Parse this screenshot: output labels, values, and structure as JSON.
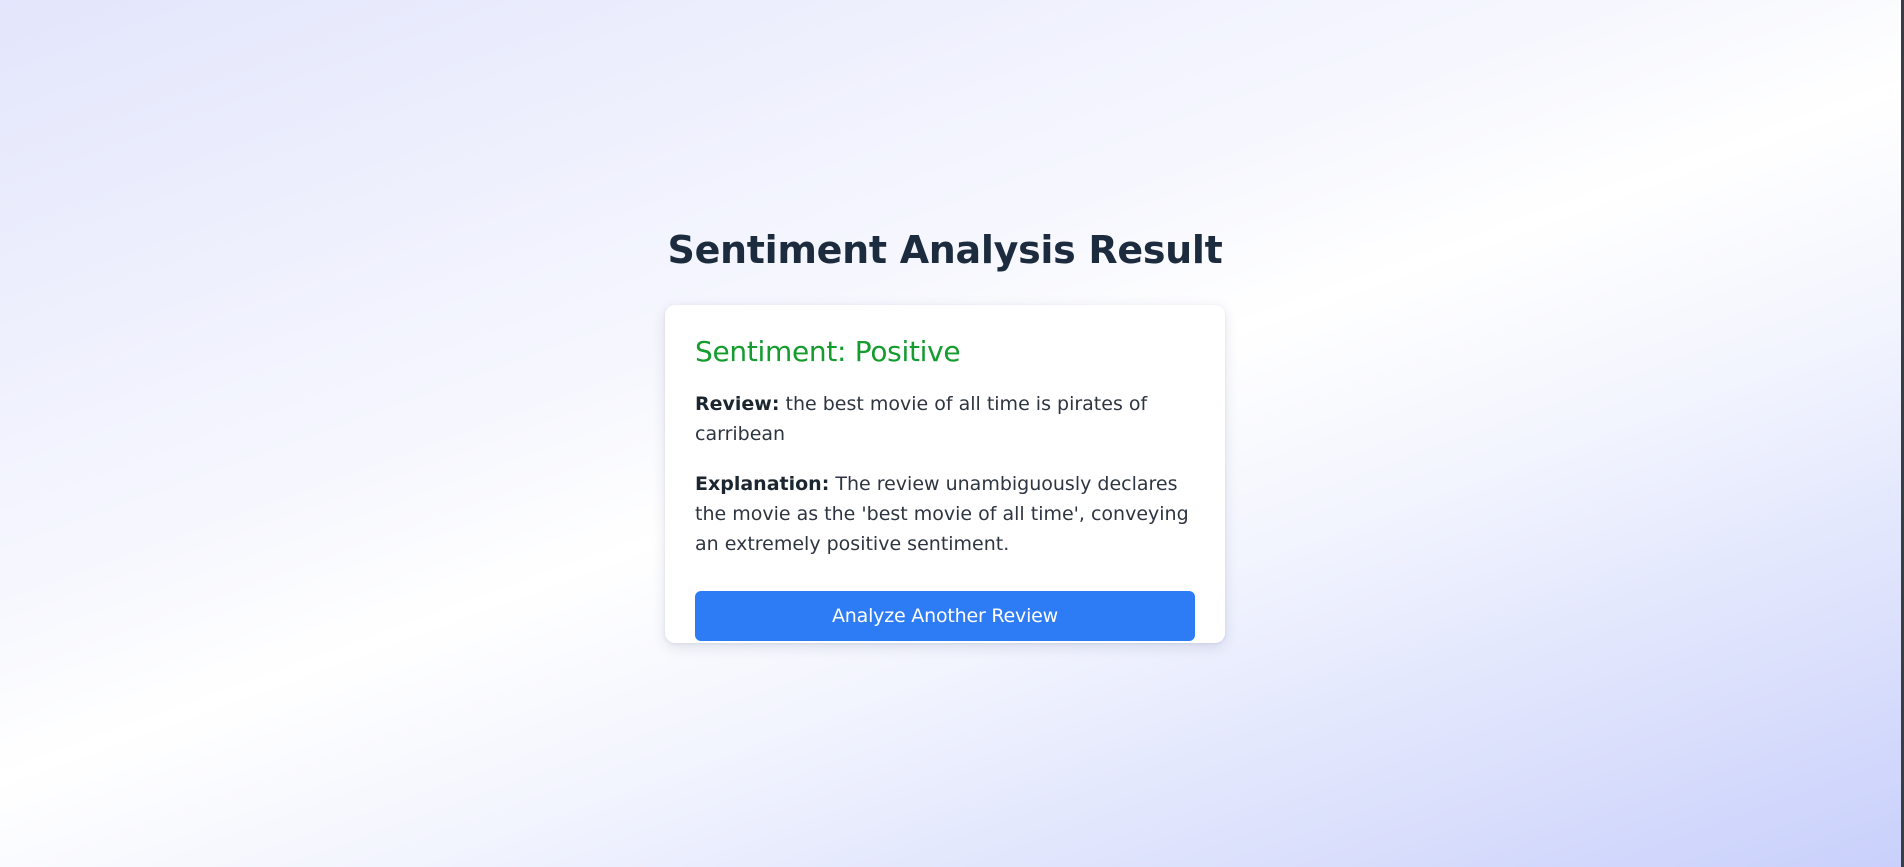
{
  "page": {
    "title": "Sentiment Analysis Result"
  },
  "result": {
    "sentiment_label": "Sentiment: Positive",
    "sentiment_color": "#149c2e",
    "review_label": "Review:",
    "review_text": " the best movie of all time is pirates of carribean",
    "explanation_label": "Explanation:",
    "explanation_text": " The review unambiguously declares the movie as the 'best movie of all time', conveying an extremely positive sentiment."
  },
  "actions": {
    "analyze_another_label": "Analyze Another Review",
    "button_color": "#2d7cf6"
  }
}
